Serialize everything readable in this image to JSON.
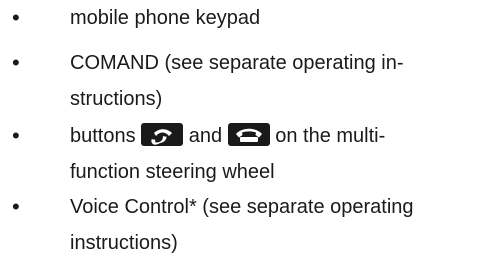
{
  "list": {
    "bullet_glyph": "•",
    "items": [
      {
        "lines": [
          "mobile phone keypad"
        ]
      },
      {
        "lines": [
          "COMAND (see separate operating in-",
          "structions)"
        ]
      },
      {
        "line1_before": "buttons",
        "line1_middle": "and",
        "line1_after": "on the multi-",
        "line2": "function steering wheel",
        "icons": [
          "phone-pickup-icon",
          "phone-hangup-icon"
        ]
      },
      {
        "lines": [
          "Voice Control* (see separate operating",
          "instructions)"
        ]
      }
    ]
  }
}
